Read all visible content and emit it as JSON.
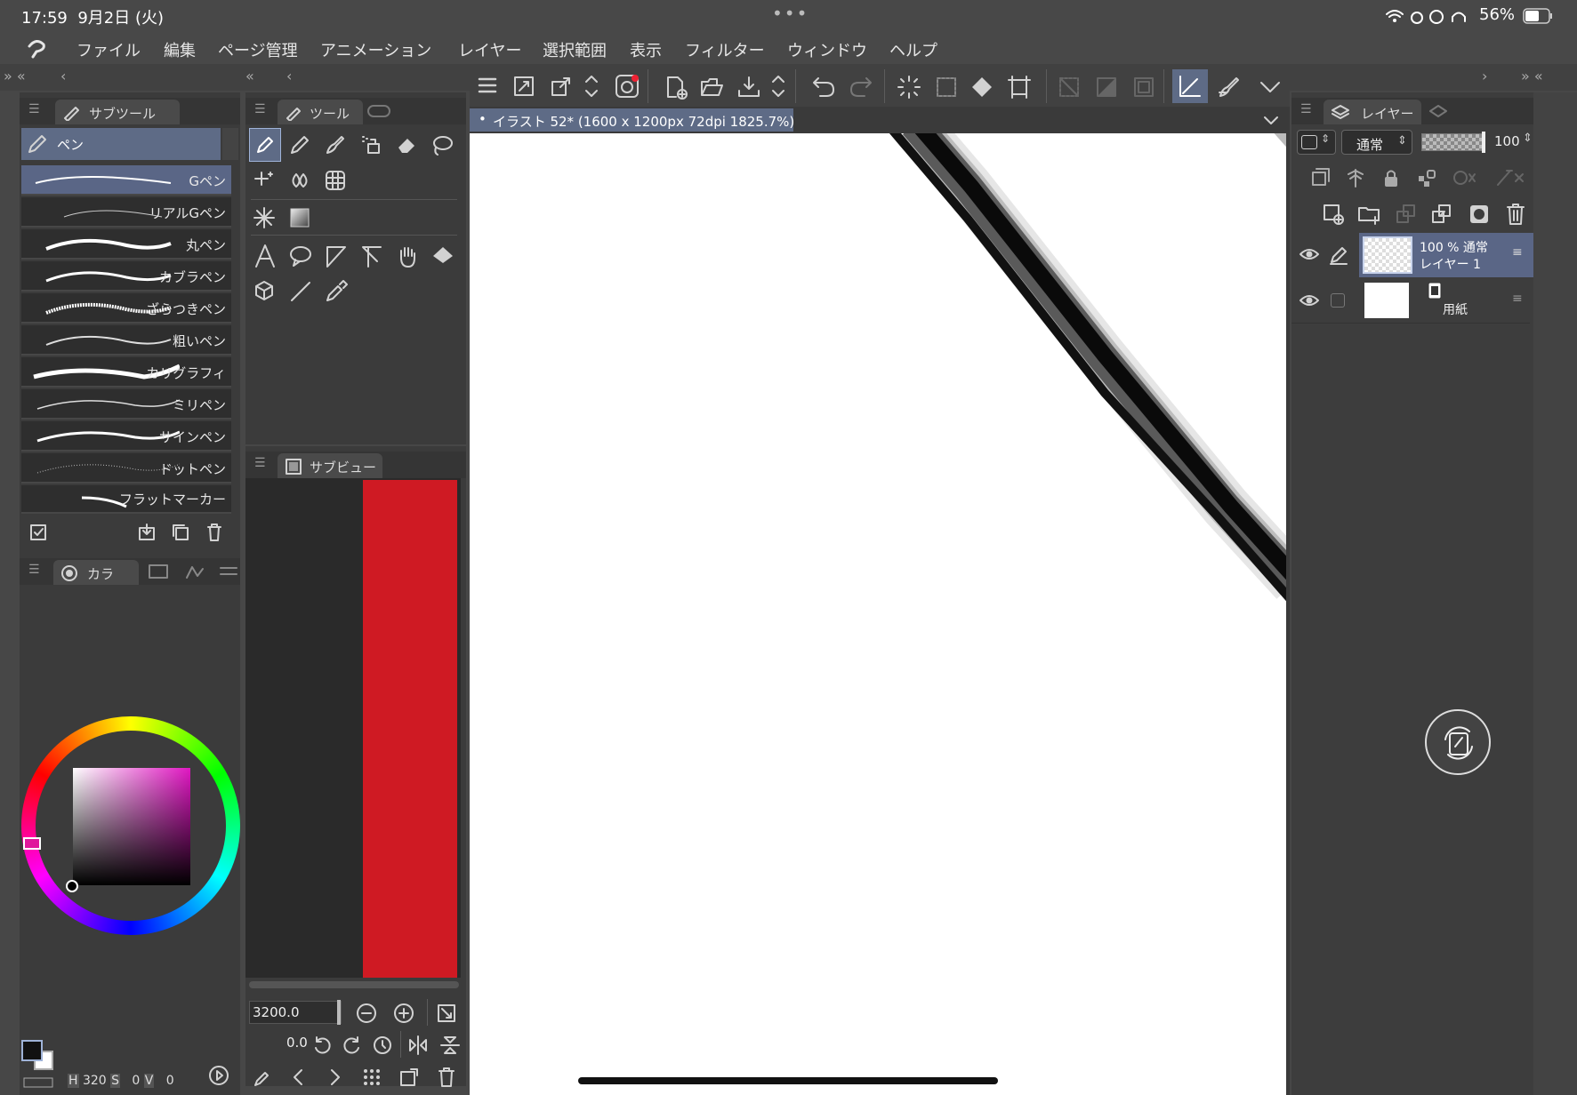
{
  "status_bar": {
    "time": "17:59",
    "date": "9月2日 (火)",
    "dots": "•••",
    "battery": "56%"
  },
  "menu": {
    "items": [
      "ファイル",
      "編集",
      "ページ管理",
      "アニメーション",
      "レイヤー",
      "選択範囲",
      "表示",
      "フィルター",
      "ウィンドウ",
      "ヘルプ"
    ]
  },
  "subtool_panel": {
    "tab": "サブツール",
    "group": "ペン",
    "brushes": [
      "Gペン",
      "リアルGペン",
      "丸ペン",
      "カブラペン",
      "ざらつきペン",
      "粗いペン",
      "カリグラフィ",
      "ミリペン",
      "サインペン",
      "ドットペン",
      "フラットマーカー"
    ],
    "selected_index": 0
  },
  "tool_panel": {
    "tab": "ツール"
  },
  "subview_panel": {
    "tab": "サブビュー",
    "preview_color": "#cf1a23"
  },
  "color_panel": {
    "tab": "カラ",
    "main_color": "#111111",
    "sub_color": "#ffffff",
    "h_value": "320",
    "s_value": "0",
    "v_value": "0",
    "h_label": "H",
    "s_label": "S",
    "v_label": "V"
  },
  "nav": {
    "zoom": "3200.0",
    "rotation": "0.0"
  },
  "canvas": {
    "tab_title": "イラスト 52* (1600 x 1200px 72dpi 1825.7%)"
  },
  "layer_panel": {
    "tab": "レイヤー",
    "blend_mode": "通常",
    "opacity": "100",
    "layers": [
      {
        "info": "100 % 通常",
        "name": "レイヤー 1",
        "selected": true
      },
      {
        "info": "",
        "name": "用紙",
        "selected": false
      }
    ]
  },
  "colors": {
    "accent": "#5e6b86",
    "selected_row": "#5a6686",
    "panel": "#3b3b3b",
    "canvas": "#ffffff"
  }
}
